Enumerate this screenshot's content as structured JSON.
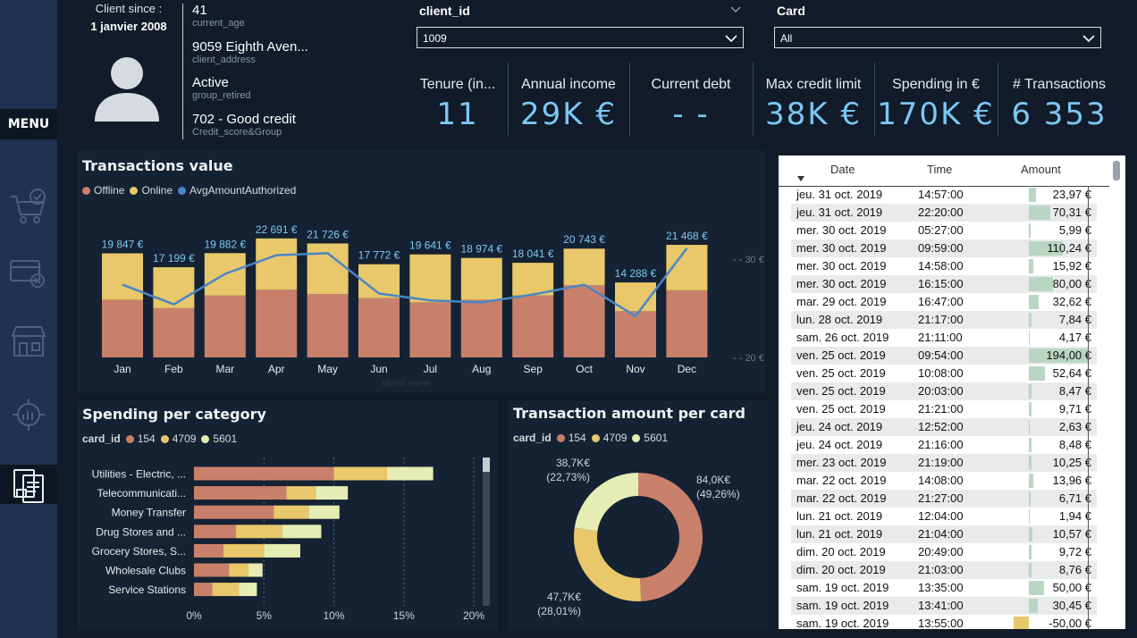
{
  "sidebar": {
    "menu_label": "MENU"
  },
  "client": {
    "since_label": "Client since :",
    "since_value": "1 janvier 2008",
    "fields": [
      {
        "value": "41",
        "label": "current_age"
      },
      {
        "value": "9059 Eighth Aven...",
        "label": "client_address"
      },
      {
        "value": "Active",
        "label": "group_retired"
      },
      {
        "value": "702 - Good credit",
        "label": "Credit_score&Group"
      }
    ]
  },
  "filters": {
    "client_id": {
      "label": "client_id",
      "value": "1009"
    },
    "card": {
      "label": "Card",
      "value": "All"
    }
  },
  "kpis": [
    {
      "title": "Tenure (in...",
      "value": "11"
    },
    {
      "title": "Annual income",
      "value": "29K €"
    },
    {
      "title": "Current debt",
      "value": "- -"
    },
    {
      "title": "Max credit limit",
      "value": "38K €"
    },
    {
      "title": "Spending in €",
      "value": "170K €"
    },
    {
      "title": "# Transactions",
      "value": "6 353"
    }
  ],
  "colors": {
    "offline": "#c9806a",
    "online": "#e8c86a",
    "avg": "#4a86c5",
    "c154": "#c9806a",
    "c4709": "#e8c86a",
    "c5601": "#e6edb4"
  },
  "chart_data": [
    {
      "type": "bar",
      "title": "Transactions value",
      "legend": [
        "Offline",
        "Online",
        "AvgAmountAuthorized"
      ],
      "categories": [
        "Jan",
        "Feb",
        "Mar",
        "Apr",
        "May",
        "Jun",
        "Jul",
        "Aug",
        "Sep",
        "Oct",
        "Nov",
        "Dec"
      ],
      "total_labels": [
        "19 847 €",
        "17 199 €",
        "19 882 €",
        "22 691 €",
        "21 726 €",
        "17 772 €",
        "19 641 €",
        "18 974 €",
        "18 041 €",
        "20 743 €",
        "14 288 €",
        "21 468 €"
      ],
      "series": [
        {
          "name": "Offline",
          "values": [
            11000,
            9400,
            11800,
            12900,
            12100,
            11300,
            10500,
            11000,
            11800,
            13800,
            8800,
            12800
          ]
        },
        {
          "name": "Online",
          "values": [
            8847,
            7799,
            8082,
            9791,
            9626,
            6472,
            9141,
            7974,
            6241,
            6943,
            5488,
            8668
          ]
        }
      ],
      "line": {
        "name": "AvgAmountAuthorized",
        "values": [
          27.4,
          25.4,
          28.5,
          30.4,
          30.6,
          26.5,
          25.8,
          25.6,
          26.4,
          27.4,
          24.2,
          31.1
        ]
      },
      "secondary_ticks": [
        "30 €",
        "20 €"
      ],
      "xlabel": "Month name"
    },
    {
      "type": "bar",
      "title": "Spending per category",
      "legend_title": "card_id",
      "legend": [
        "154",
        "4709",
        "5601"
      ],
      "categories": [
        "Utilities - Electric, ...",
        "Telecommunicati...",
        "Money Transfer",
        "Drug Stores and ...",
        "Grocery Stores, S...",
        "Wholesale Clubs",
        "Service Stations"
      ],
      "series": [
        {
          "name": "154",
          "values": [
            10.0,
            6.6,
            5.7,
            3.0,
            2.1,
            2.5,
            1.3
          ]
        },
        {
          "name": "4709",
          "values": [
            3.8,
            2.1,
            2.5,
            3.3,
            2.9,
            1.4,
            1.9
          ]
        },
        {
          "name": "5601",
          "values": [
            3.3,
            2.3,
            2.2,
            2.8,
            2.6,
            1.0,
            1.3
          ]
        }
      ],
      "x_ticks": [
        "0%",
        "5%",
        "10%",
        "15%",
        "20%"
      ],
      "xlim": [
        0,
        20
      ]
    },
    {
      "type": "pie",
      "title": "Transaction amount per card",
      "legend_title": "card_id",
      "legend": [
        "154",
        "4709",
        "5601"
      ],
      "values": [
        84.0,
        47.7,
        38.7
      ],
      "labels": [
        {
          "value": "84,0K€",
          "pct": "(49,26%)"
        },
        {
          "value": "47,7K€",
          "pct": "(28,01%)"
        },
        {
          "value": "38,7K€",
          "pct": "(22,73%)"
        }
      ]
    }
  ],
  "transactions": {
    "headers": {
      "date": "Date",
      "time": "Time",
      "amount": "Amount"
    },
    "rows": [
      {
        "date": "jeu. 31 oct. 2019",
        "time": "14:57:00",
        "amount": "23,97 €",
        "v": 23.97
      },
      {
        "date": "jeu. 31 oct. 2019",
        "time": "22:20:00",
        "amount": "70,31 €",
        "v": 70.31
      },
      {
        "date": "mer. 30 oct. 2019",
        "time": "05:27:00",
        "amount": "5,99 €",
        "v": 5.99
      },
      {
        "date": "mer. 30 oct. 2019",
        "time": "09:59:00",
        "amount": "110,24 €",
        "v": 110.24
      },
      {
        "date": "mer. 30 oct. 2019",
        "time": "14:58:00",
        "amount": "15,92 €",
        "v": 15.92
      },
      {
        "date": "mer. 30 oct. 2019",
        "time": "16:15:00",
        "amount": "80,00 €",
        "v": 80.0
      },
      {
        "date": "mar. 29 oct. 2019",
        "time": "16:47:00",
        "amount": "32,62 €",
        "v": 32.62
      },
      {
        "date": "lun. 28 oct. 2019",
        "time": "21:17:00",
        "amount": "7,84 €",
        "v": 7.84
      },
      {
        "date": "sam. 26 oct. 2019",
        "time": "21:11:00",
        "amount": "4,17 €",
        "v": 4.17
      },
      {
        "date": "ven. 25 oct. 2019",
        "time": "09:54:00",
        "amount": "194,00 €",
        "v": 194.0
      },
      {
        "date": "ven. 25 oct. 2019",
        "time": "10:08:00",
        "amount": "52,64 €",
        "v": 52.64
      },
      {
        "date": "ven. 25 oct. 2019",
        "time": "20:03:00",
        "amount": "8,47 €",
        "v": 8.47
      },
      {
        "date": "ven. 25 oct. 2019",
        "time": "21:21:00",
        "amount": "9,71 €",
        "v": 9.71
      },
      {
        "date": "jeu. 24 oct. 2019",
        "time": "12:52:00",
        "amount": "2,63 €",
        "v": 2.63
      },
      {
        "date": "jeu. 24 oct. 2019",
        "time": "21:16:00",
        "amount": "8,48 €",
        "v": 8.48
      },
      {
        "date": "mer. 23 oct. 2019",
        "time": "21:19:00",
        "amount": "10,25 €",
        "v": 10.25
      },
      {
        "date": "mar. 22 oct. 2019",
        "time": "14:08:00",
        "amount": "13,96 €",
        "v": 13.96
      },
      {
        "date": "mar. 22 oct. 2019",
        "time": "21:27:00",
        "amount": "6,71 €",
        "v": 6.71
      },
      {
        "date": "lun. 21 oct. 2019",
        "time": "12:04:00",
        "amount": "1,94 €",
        "v": 1.94
      },
      {
        "date": "lun. 21 oct. 2019",
        "time": "21:04:00",
        "amount": "10,57 €",
        "v": 10.57
      },
      {
        "date": "dim. 20 oct. 2019",
        "time": "20:49:00",
        "amount": "9,72 €",
        "v": 9.72
      },
      {
        "date": "dim. 20 oct. 2019",
        "time": "21:03:00",
        "amount": "8,76 €",
        "v": 8.76
      },
      {
        "date": "sam. 19 oct. 2019",
        "time": "13:35:00",
        "amount": "50,00 €",
        "v": 50.0
      },
      {
        "date": "sam. 19 oct. 2019",
        "time": "13:41:00",
        "amount": "30,45 €",
        "v": 30.45
      },
      {
        "date": "sam. 19 oct. 2019",
        "time": "13:55:00",
        "amount": "-50,00 €",
        "v": -50.0
      }
    ]
  }
}
